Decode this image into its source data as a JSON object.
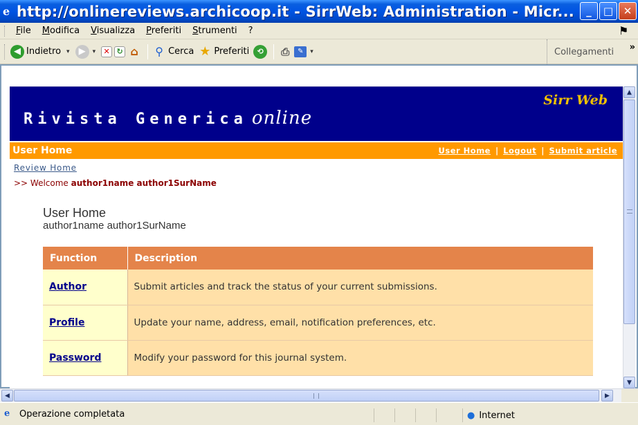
{
  "window": {
    "title": "http://onlinereviews.archicoop.it - SirrWeb: Administration - Micr...",
    "ie_icon": "ie-logo-icon",
    "buttons": [
      "minimize",
      "maximize",
      "close"
    ]
  },
  "menubar": {
    "items": [
      "File",
      "Modifica",
      "Visualizza",
      "Preferiti",
      "Strumenti",
      "?"
    ]
  },
  "toolbar": {
    "back_label": "Indietro",
    "search_label": "Cerca",
    "favorites_label": "Preferiti",
    "links_label": "Collegamenti"
  },
  "page": {
    "site_title": "Rivista Generica",
    "site_title_suffix": "online",
    "brand": "Sirr Web",
    "page_label": "User Home",
    "nav_links": [
      "User Home",
      "Logout",
      "Submit article"
    ],
    "breadcrumb": "Review Home",
    "welcome_prefix": ">> Welcome",
    "welcome_name": "author1name author1SurName",
    "heading": "User Home",
    "user_name": "author1name author1SurName",
    "table": {
      "headers": [
        "Function",
        "Description"
      ],
      "rows": [
        {
          "function": "Author",
          "description": "Submit articles and track the status of your current submissions."
        },
        {
          "function": "Profile",
          "description": "Update your name, address, email, notification preferences, etc."
        },
        {
          "function": "Password",
          "description": "Modify your password for this journal system."
        }
      ]
    }
  },
  "statusbar": {
    "text": "Operazione completata",
    "zone": "Internet"
  },
  "colors": {
    "banner_bg": "#00008b",
    "nav_strip": "#ff9900",
    "table_header": "#e4844a",
    "function_cell": "#ffffcc",
    "description_cell": "#ffe0a8"
  }
}
